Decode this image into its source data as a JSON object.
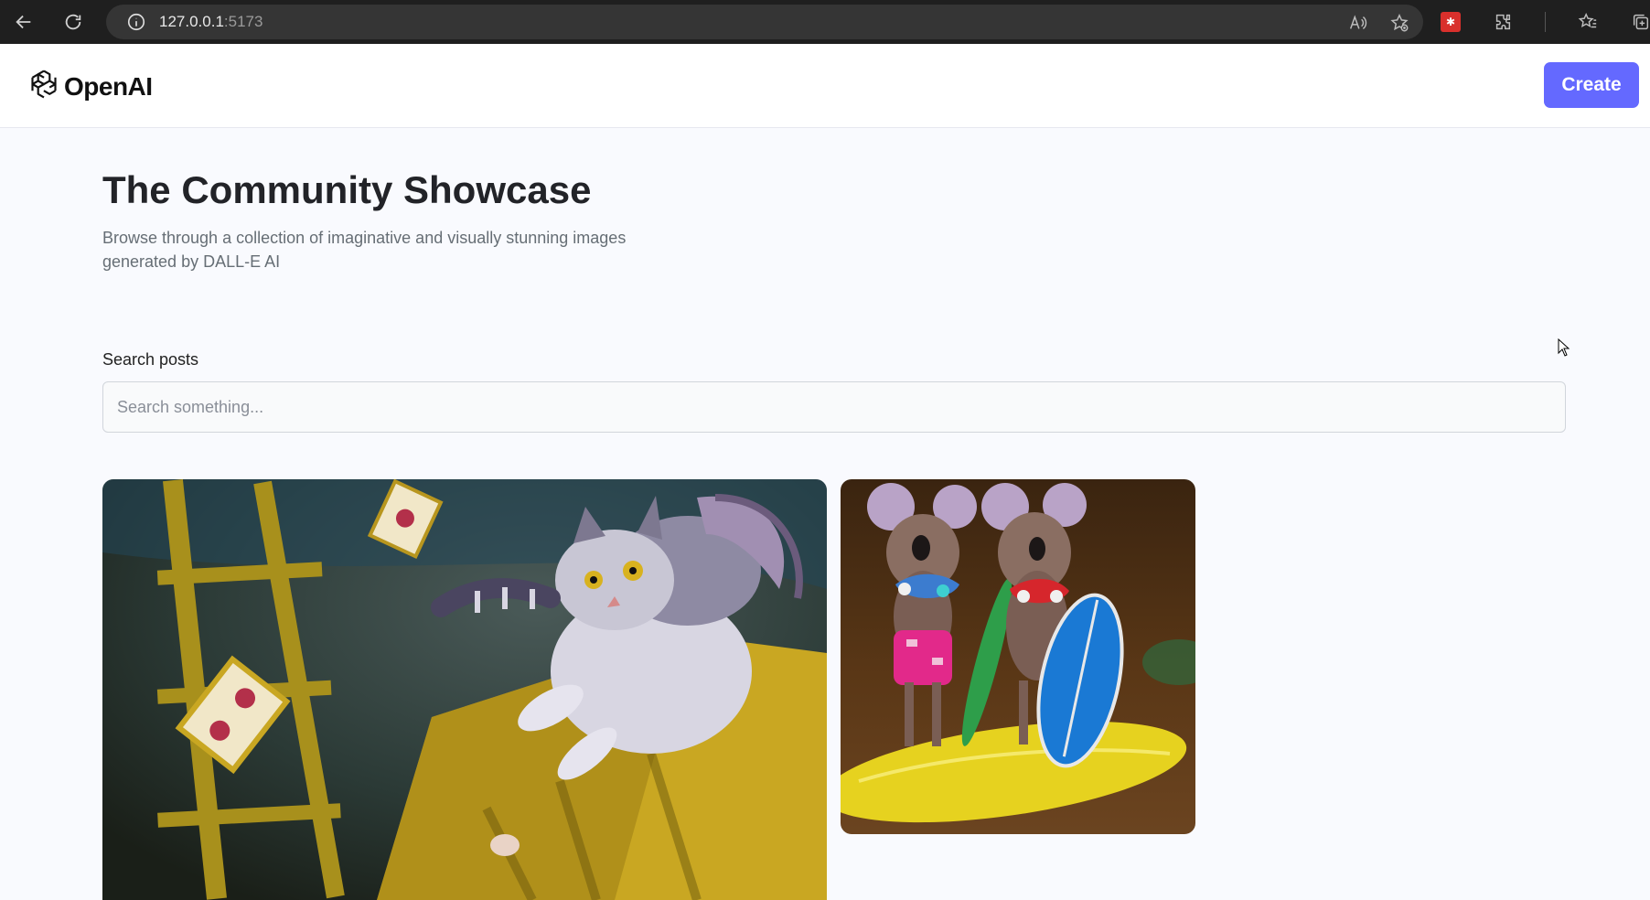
{
  "browser": {
    "url_host": "127.0.0.1",
    "url_port": ":5173"
  },
  "header": {
    "logo_text": "OpenAI",
    "create_label": "Create"
  },
  "main": {
    "title": "The Community Showcase",
    "subtitle": "Browse through a collection of imaginative and visually stunning images generated by DALL-E AI",
    "search_label": "Search posts",
    "search_placeholder": "Search something..."
  },
  "icons": [
    "back-icon",
    "reload-icon",
    "info-icon",
    "read-aloud-icon",
    "favorite-add-icon",
    "extension-icon",
    "puzzle-icon",
    "favorites-icon",
    "collections-icon",
    "openai-logo-icon"
  ],
  "colors": {
    "accent": "#6469ff",
    "page_bg": "#f9fafe",
    "title": "#222328",
    "subtitle": "#666e75"
  }
}
